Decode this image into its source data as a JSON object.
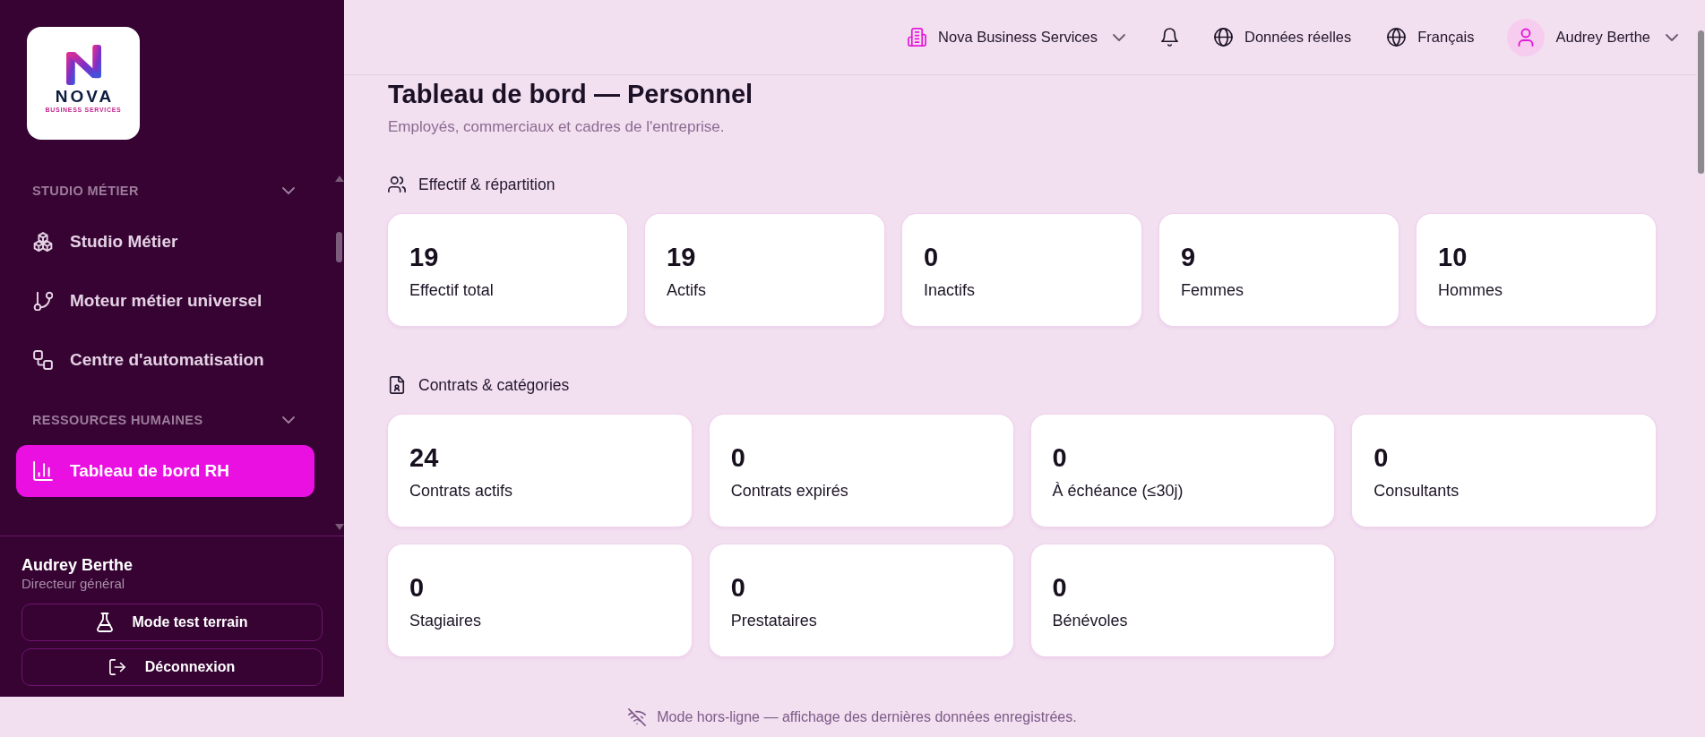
{
  "sidebar": {
    "logo": {
      "name": "NOVA",
      "tagline": "BUSINESS SERVICES"
    },
    "sections": [
      {
        "title": "STUDIO MÉTIER",
        "expanded": true,
        "items": [
          {
            "label": "Studio Métier",
            "selected": false
          },
          {
            "label": "Moteur métier universel",
            "selected": false
          },
          {
            "label": "Centre d'automatisation",
            "selected": false
          }
        ]
      },
      {
        "title": "RESSOURCES HUMAINES",
        "expanded": true,
        "items": [
          {
            "label": "Tableau de bord RH",
            "selected": true
          }
        ]
      }
    ],
    "user": {
      "name": "Audrey Berthe",
      "role": "Directeur général"
    },
    "buttons": [
      "Mode test terrain",
      "Déconnexion"
    ]
  },
  "header": {
    "organization": "Nova Business Services",
    "data_source": "Données réelles",
    "language": "Français",
    "user_name": "Audrey Berthe"
  },
  "page": {
    "title": "Tableau de bord — Personnel",
    "subtitle": "Employés, commerciaux et cadres de l'entreprise."
  },
  "sections": [
    {
      "title": "Effectif & répartition",
      "cards": [
        {
          "value": "19",
          "label": "Effectif total"
        },
        {
          "value": "19",
          "label": "Actifs"
        },
        {
          "value": "0",
          "label": "Inactifs"
        },
        {
          "value": "9",
          "label": "Femmes"
        },
        {
          "value": "10",
          "label": "Hommes"
        }
      ]
    },
    {
      "title": "Contrats & catégories",
      "cards": [
        {
          "value": "24",
          "label": "Contrats actifs"
        },
        {
          "value": "0",
          "label": "Contrats expirés"
        },
        {
          "value": "0",
          "label": "À échéance (≤30j)"
        },
        {
          "value": "0",
          "label": "Consultants"
        },
        {
          "value": "0",
          "label": "Stagiaires"
        },
        {
          "value": "0",
          "label": "Prestataires"
        },
        {
          "value": "0",
          "label": "Bénévoles"
        }
      ]
    }
  ],
  "status_bar": {
    "text": "Mode hors-ligne — affichage des dernières données enregistrées."
  }
}
